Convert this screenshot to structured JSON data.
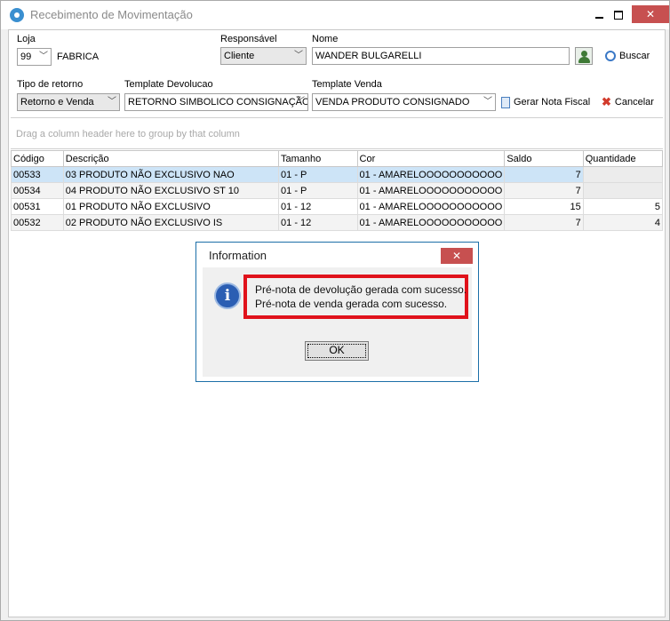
{
  "window": {
    "title": "Recebimento de Movimentação"
  },
  "form": {
    "loja": {
      "label": "Loja",
      "value": "99",
      "name": "FABRICA"
    },
    "responsavel": {
      "label": "Responsável",
      "value": "Cliente"
    },
    "nome": {
      "label": "Nome",
      "value": "WANDER BULGARELLI"
    },
    "buscar_label": "Buscar",
    "tipo_retorno": {
      "label": "Tipo de retorno",
      "value": "Retorno e Venda"
    },
    "template_devolucao": {
      "label": "Template Devolucao",
      "value": "RETORNO SIMBOLICO CONSIGNAÇÃO"
    },
    "template_venda": {
      "label": "Template Venda",
      "value": "VENDA PRODUTO CONSIGNADO"
    },
    "gerar_nota_label": "Gerar Nota Fiscal",
    "cancelar_label": "Cancelar"
  },
  "grid": {
    "group_hint": "Drag a column header here to group by that column",
    "columns": [
      "Código",
      "Descrição",
      "Tamanho",
      "Cor",
      "Saldo",
      "Quantidade"
    ],
    "rows": [
      {
        "codigo": "00533",
        "descricao": "03 PRODUTO NÃO EXCLUSIVO NAO",
        "tamanho": "01 - P",
        "cor": "01 - AMARELOOOOOOOOOOO",
        "saldo": "7",
        "quantidade": ""
      },
      {
        "codigo": "00534",
        "descricao": "04 PRODUTO NÃO EXCLUSIVO ST 10",
        "tamanho": "01 - P",
        "cor": "01 - AMARELOOOOOOOOOOO",
        "saldo": "7",
        "quantidade": ""
      },
      {
        "codigo": "00531",
        "descricao": "01 PRODUTO NÃO EXCLUSIVO",
        "tamanho": "01 - 12",
        "cor": "01 - AMARELOOOOOOOOOOO",
        "saldo": "15",
        "quantidade": "5"
      },
      {
        "codigo": "00532",
        "descricao": "02 PRODUTO NÃO EXCLUSIVO IS",
        "tamanho": "01 - 12",
        "cor": "01 - AMARELOOOOOOOOOOO",
        "saldo": "7",
        "quantidade": "4"
      }
    ]
  },
  "dialog": {
    "title": "Information",
    "messages": [
      "Pré-nota de devolução gerada com sucesso.",
      "Pré-nota de venda gerada com sucesso."
    ],
    "ok_label": "OK"
  },
  "colors": {
    "highlight": "#e0121b",
    "close_button": "#c75050",
    "selected_row": "#cde4f7",
    "dialog_border": "#1c6fa8"
  }
}
